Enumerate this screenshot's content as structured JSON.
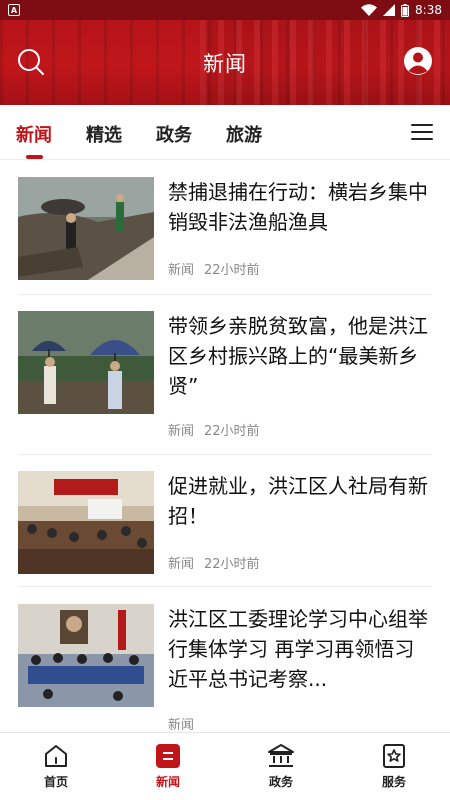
{
  "status_bar": {
    "app_badge": "A",
    "time": "8:38"
  },
  "header": {
    "title": "新闻",
    "search_icon": "search-icon",
    "profile_icon": "user-avatar-icon"
  },
  "tabs": [
    {
      "label": "新闻",
      "active": true
    },
    {
      "label": "精选",
      "active": false
    },
    {
      "label": "政务",
      "active": false
    },
    {
      "label": "旅游",
      "active": false
    }
  ],
  "menu_icon": "hamburger-menu-icon",
  "news": [
    {
      "title": "禁捕退捕在行动：横岩乡集中销毁非法渔船渔具",
      "source": "新闻",
      "time": "22小时前"
    },
    {
      "title": "带领乡亲脱贫致富，他是洪江区乡村振兴路上的“最美新乡贤”",
      "source": "新闻",
      "time": "22小时前"
    },
    {
      "title": "促进就业，洪江区人社局有新招！",
      "source": "新闻",
      "time": "22小时前"
    },
    {
      "title": "洪江区工委理论学习中心组举行集体学习 再学习再领悟习近平总书记考察...",
      "source": "新闻",
      "time": ""
    }
  ],
  "bottom_nav": [
    {
      "label": "首页",
      "icon": "home-icon",
      "active": false
    },
    {
      "label": "新闻",
      "icon": "news-icon",
      "active": true
    },
    {
      "label": "政务",
      "icon": "government-building-icon",
      "active": false
    },
    {
      "label": "服务",
      "icon": "service-icon",
      "active": false
    }
  ],
  "colors": {
    "brand_red": "#c0161b",
    "status_bar": "#7d0d12",
    "meta_gray": "#888888"
  }
}
